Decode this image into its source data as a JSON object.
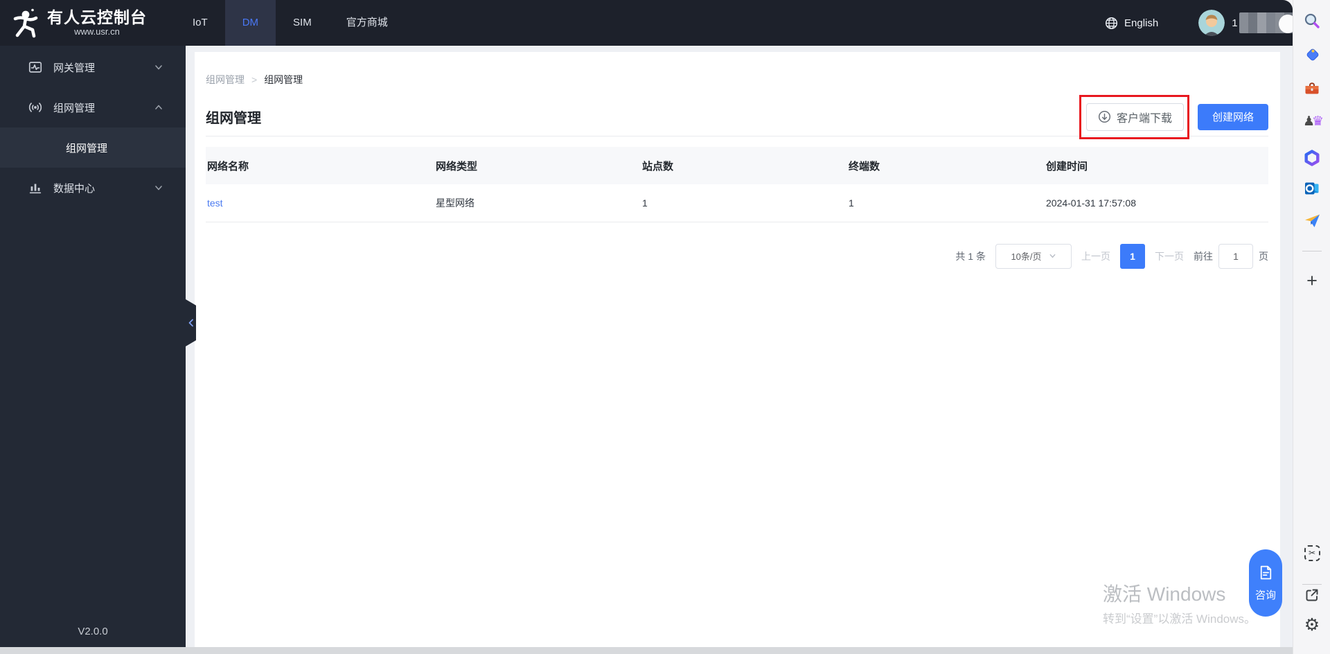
{
  "header": {
    "logo_title": "有人云控制台",
    "logo_subtitle": "www.usr.cn",
    "tabs": [
      {
        "label": "IoT",
        "active": false
      },
      {
        "label": "DM",
        "active": true
      },
      {
        "label": "SIM",
        "active": false
      },
      {
        "label": "官方商城",
        "active": false
      }
    ],
    "language": "English",
    "username_visible": "1"
  },
  "sidebar": {
    "items": [
      {
        "label": "网关管理",
        "icon": "gateway-icon",
        "expanded": false
      },
      {
        "label": "组网管理",
        "icon": "signal-icon",
        "expanded": true
      },
      {
        "label": "数据中心",
        "icon": "bar-chart-icon",
        "expanded": false
      }
    ],
    "submenu_active": "组网管理",
    "version": "V2.0.0"
  },
  "breadcrumb": {
    "parent": "组网管理",
    "separator": ">",
    "current": "组网管理"
  },
  "page": {
    "title": "组网管理",
    "download_button": "客户端下载",
    "create_button": "创建网络"
  },
  "table": {
    "columns": [
      "网络名称",
      "网络类型",
      "站点数",
      "终端数",
      "创建时间"
    ],
    "rows": [
      [
        "test",
        "星型网络",
        "1",
        "1",
        "2024-01-31 17:57:08"
      ]
    ]
  },
  "pagination": {
    "total": "共 1 条",
    "page_size": "10条/页",
    "prev": "上一页",
    "current_page": "1",
    "next": "下一页",
    "goto_label": "前往",
    "goto_value": "1",
    "goto_suffix": "页"
  },
  "floating": {
    "consult": "咨询"
  },
  "watermark": {
    "line1": "激活 Windows",
    "line2": "转到“设置”以激活 Windows。"
  },
  "browser_sidebar": {
    "icons_top": [
      "search-icon",
      "shopping-icon",
      "tools-icon",
      "games-icon",
      "microsoft-365-icon",
      "outlook-icon",
      "drop-icon",
      "add-icon"
    ],
    "icons_bottom": [
      "screenshot-icon",
      "open-external-icon",
      "settings-icon"
    ]
  },
  "colors": {
    "accent_blue": "#3c7bfa",
    "annotation_red": "#e8171f",
    "header_bg": "#1d212b",
    "sidebar_bg": "#232935",
    "active_tab_bg": "#2e3447",
    "link_blue": "#4a7af0"
  }
}
